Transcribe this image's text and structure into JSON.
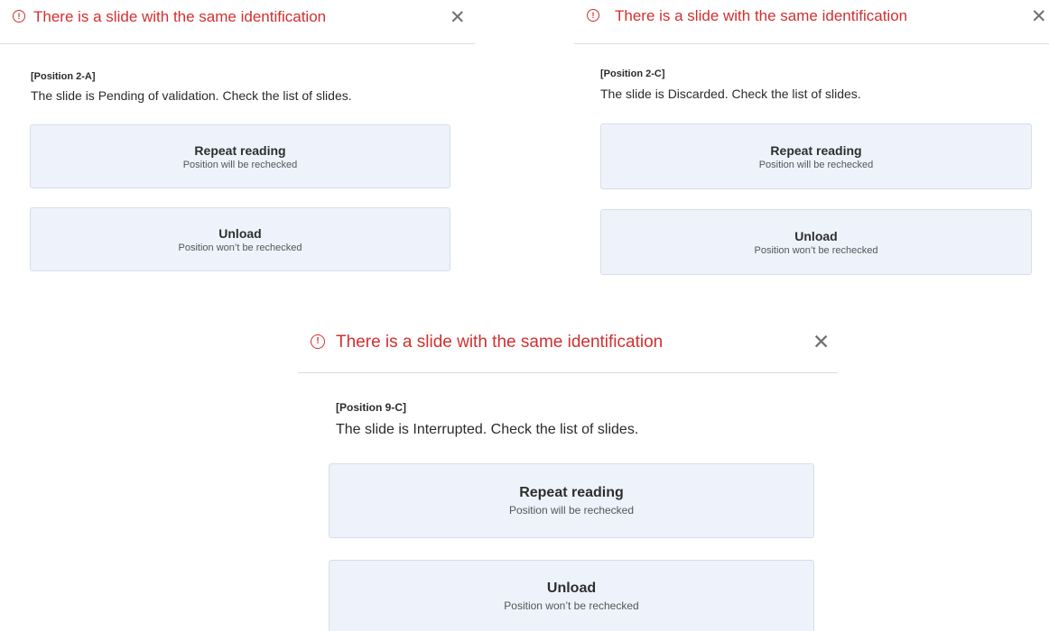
{
  "icons": {
    "warning": "warning-circle-icon",
    "close": "close-icon"
  },
  "colors": {
    "alert": "#d32f2f",
    "button_bg": "#eef3fb",
    "button_border": "#d7dde7"
  },
  "dialogs": [
    {
      "icon_glyph": "!",
      "title": "There is a slide with the same identification",
      "close_glyph": "✕",
      "position_label": "[Position 2-A]",
      "status_message": "The slide is Pending of validation. Check the list of slides.",
      "repeat_button": {
        "label": "Repeat reading",
        "sublabel": "Position will be rechecked"
      },
      "unload_button": {
        "label": "Unload",
        "sublabel": "Position won’t be rechecked"
      }
    },
    {
      "icon_glyph": "!",
      "title": "There is a slide with the same identification",
      "close_glyph": "✕",
      "position_label": "[Position 2-C]",
      "status_message": "The slide is Discarded. Check the list of slides.",
      "repeat_button": {
        "label": "Repeat reading",
        "sublabel": "Position will be rechecked"
      },
      "unload_button": {
        "label": "Unload",
        "sublabel": "Position won’t be rechecked"
      }
    },
    {
      "icon_glyph": "!",
      "title": "There is a slide with the same identification",
      "close_glyph": "✕",
      "position_label": "[Position 9-C]",
      "status_message": "The slide is Interrupted. Check the list of slides.",
      "repeat_button": {
        "label": "Repeat reading",
        "sublabel": "Position will be rechecked"
      },
      "unload_button": {
        "label": "Unload",
        "sublabel": "Position won’t be rechecked"
      }
    }
  ]
}
